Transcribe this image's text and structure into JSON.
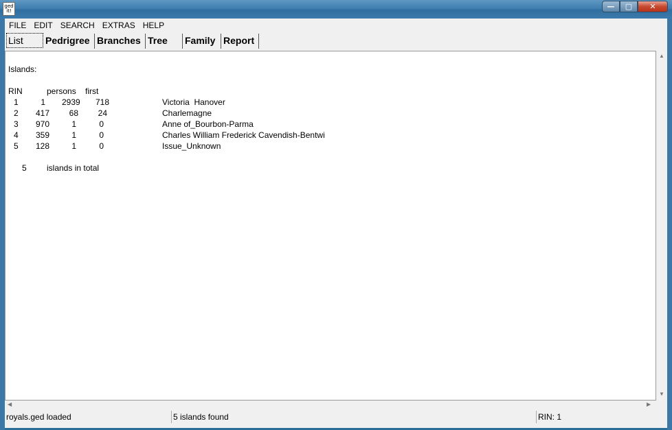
{
  "window": {
    "icon_text": "ged\nit!",
    "buttons": {
      "minimize": "—",
      "maximize": "▢",
      "close": "✕"
    }
  },
  "menu": [
    "FILE",
    "EDIT",
    "SEARCH",
    "EXTRAS",
    "HELP"
  ],
  "tabs": [
    "List",
    "Pedrigree",
    "Branches",
    "Tree",
    "Family",
    "Report"
  ],
  "content": {
    "heading": "Islands:",
    "columns": {
      "rin": "RIN",
      "persons": "persons",
      "first": "first"
    },
    "rows": [
      {
        "rin": "1",
        "a": "1",
        "persons": "2939",
        "first": "718",
        "name": "Victoria  Hanover"
      },
      {
        "rin": "2",
        "a": "417",
        "persons": "68",
        "first": "24",
        "name": "Charlemagne"
      },
      {
        "rin": "3",
        "a": "970",
        "persons": "1",
        "first": "0",
        "name": "Anne of_Bourbon-Parma"
      },
      {
        "rin": "4",
        "a": "359",
        "persons": "1",
        "first": "0",
        "name": "Charles William Frederick Cavendish-Bentwi"
      },
      {
        "rin": "5",
        "a": "128",
        "persons": "1",
        "first": "0",
        "name": "Issue_Unknown"
      }
    ],
    "total_count": "5",
    "total_label": "islands in total"
  },
  "status": {
    "left": "royals.ged loaded",
    "middle": "5 islands found",
    "right": "RIN: 1"
  }
}
